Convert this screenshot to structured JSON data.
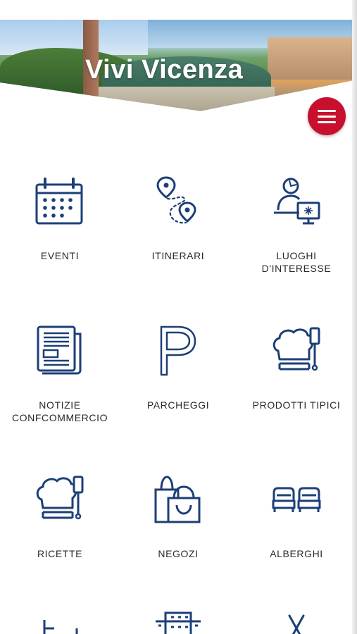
{
  "header": {
    "title": "Vivi Vicenza"
  },
  "menu": {
    "icon": "hamburger-menu-icon"
  },
  "colors": {
    "brand": "#c8102e",
    "icon": "#1c3f77",
    "text": "#2a2a2a"
  },
  "tiles": [
    {
      "label": "EVENTI",
      "icon": "calendar-icon"
    },
    {
      "label": "ITINERARI",
      "icon": "route-icon"
    },
    {
      "label": "LUOGHI\nD'INTERESSE",
      "icon": "info-point-icon"
    },
    {
      "label": "NOTIZIE\nCONFCOMMERCIO",
      "icon": "newspaper-icon"
    },
    {
      "label": "PARCHEGGI",
      "icon": "parking-icon"
    },
    {
      "label": "PRODOTTI TIPICI",
      "icon": "chef-hat-icon"
    },
    {
      "label": "RICETTE",
      "icon": "chef-hat-icon"
    },
    {
      "label": "NEGOZI",
      "icon": "shopping-bag-icon"
    },
    {
      "label": "ALBERGHI",
      "icon": "beds-icon"
    }
  ]
}
